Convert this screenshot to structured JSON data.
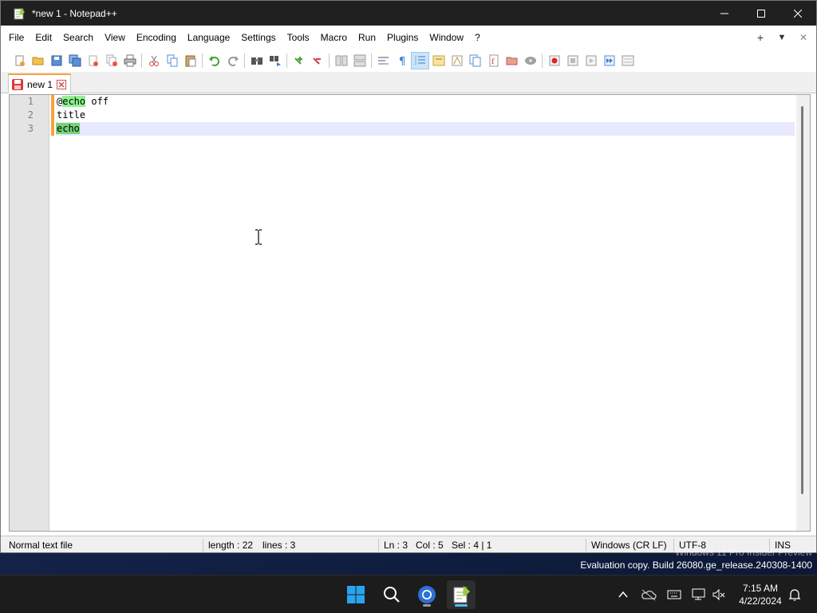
{
  "window": {
    "title": "*new 1 - Notepad++"
  },
  "menu": {
    "items": [
      "File",
      "Edit",
      "Search",
      "View",
      "Encoding",
      "Language",
      "Settings",
      "Tools",
      "Macro",
      "Run",
      "Plugins",
      "Window",
      "?"
    ],
    "right": {
      "add": "+",
      "dropdown": "▼",
      "close": "✕"
    }
  },
  "toolbar": {
    "buttons": [
      "new-file-icon",
      "open-file-icon",
      "save-icon",
      "save-all-icon",
      "close-icon",
      "close-all-icon",
      "print-icon",
      "cut-icon",
      "copy-icon",
      "paste-icon",
      "undo-icon",
      "redo-icon",
      "find-icon",
      "replace-icon",
      "zoom-in-icon",
      "zoom-out-icon",
      "sync-vertical-icon",
      "sync-horizontal-icon",
      "word-wrap-icon",
      "show-all-characters-icon",
      "indent-guide-icon",
      "user-defined-language-icon",
      "document-map-icon",
      "document-list-icon",
      "function-list-icon",
      "folder-as-workspace-icon",
      "monitoring-icon",
      "record-macro-icon",
      "stop-recording-icon",
      "play-macro-icon",
      "run-macro-multiple-icon",
      "save-macro-icon"
    ],
    "active": "indent-guide-icon"
  },
  "tabs": [
    {
      "label": "new 1",
      "modified": true
    }
  ],
  "editor": {
    "lines": [
      {
        "number": "1",
        "segments": [
          {
            "text": "@",
            "hl": ""
          },
          {
            "text": "echo",
            "hl": "match"
          },
          {
            "text": " off",
            "hl": ""
          }
        ]
      },
      {
        "number": "2",
        "segments": [
          {
            "text": "title",
            "hl": ""
          }
        ]
      },
      {
        "number": "3",
        "segments": [
          {
            "text": "echo",
            "hl": "selection"
          }
        ]
      }
    ],
    "current_line": 3
  },
  "status": {
    "filetype": "Normal text file",
    "length": "length : 22",
    "lines": "lines : 3",
    "ln": "Ln : 3",
    "col": "Col : 5",
    "sel": "Sel : 4 | 1",
    "eol": "Windows (CR LF)",
    "encoding": "UTF-8",
    "mode": "INS"
  },
  "desktop": {
    "watermark_line1": "Windows 11 Pro Insider Preview",
    "watermark_line2": "Evaluation copy. Build 26080.ge_release.240308-1400"
  },
  "taskbar": {
    "time": "7:15 AM",
    "date": "4/22/2024",
    "apps": [
      "start-icon",
      "search-icon",
      "chrome-icon",
      "notepadpp-icon"
    ],
    "tray": [
      "chevron-up-icon",
      "onedrive-icon",
      "keyboard-icon",
      "network-icon",
      "volume-icon",
      "notification-bell-icon"
    ]
  },
  "colors": {
    "accent_orange": "#f9a13b",
    "match_highlight": "#8ff28f",
    "selection_highlight": "#76d276",
    "current_line": "#e8e8ff",
    "taskbar_accent": "#4cc2ff"
  }
}
